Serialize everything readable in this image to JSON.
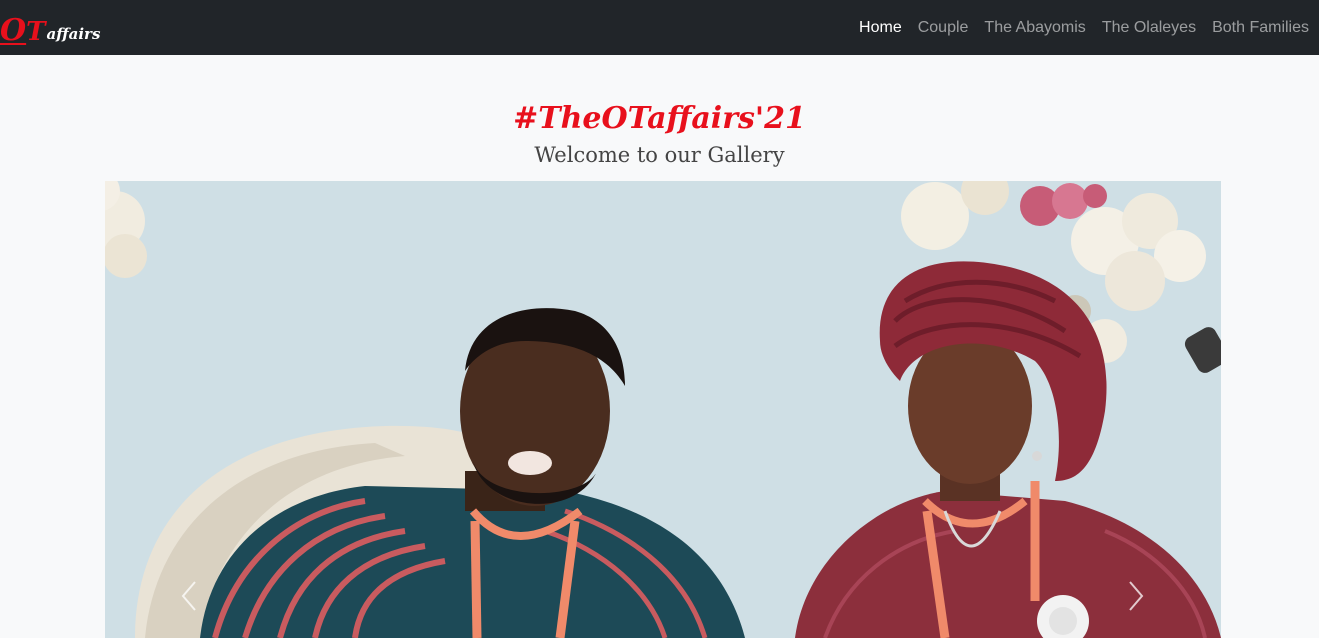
{
  "brand": {
    "letter_o": "O",
    "letter_t": "T",
    "rest": "affairs",
    "color_primary": "#e8101c",
    "color_secondary": "#ffffff"
  },
  "nav": {
    "items": [
      {
        "label": "Home",
        "active": true
      },
      {
        "label": "Couple",
        "active": false
      },
      {
        "label": "The Abayomis",
        "active": false
      },
      {
        "label": "The Olaleyes",
        "active": false
      },
      {
        "label": "Both Families",
        "active": false
      }
    ]
  },
  "header": {
    "hashtag": "#TheOTaffairs'21",
    "hashtag_color": "#e8101c",
    "subtitle": "Welcome to our Gallery"
  },
  "carousel": {
    "photo_icon": "couple-photo",
    "prev_icon": "chevron-left-icon",
    "next_icon": "chevron-right-icon"
  },
  "colors": {
    "navbar_bg": "#212529",
    "page_bg": "#f8f9fa",
    "accent": "#e8101c"
  }
}
